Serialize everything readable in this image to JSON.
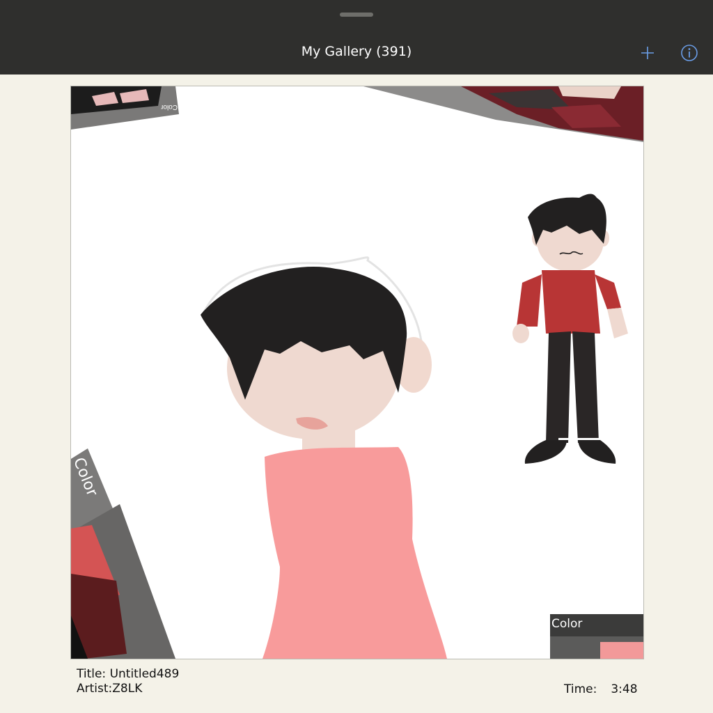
{
  "header": {
    "title": "My Gallery (391)",
    "add_icon": "plus-icon",
    "info_icon": "info-icon",
    "accent": "#6b9ee8"
  },
  "artwork": {
    "panel_labels": [
      "Color",
      "Color",
      "Color"
    ],
    "colors": {
      "hair": "#222020",
      "skin": "#efd9d0",
      "shirt_large": "#f89b9b",
      "shirt_small": "#b83535",
      "pants": "#2a2626"
    }
  },
  "footer": {
    "title_label": "Title: ",
    "title_value": "Untitled489",
    "artist_label": "Artist:",
    "artist_value": "Z8LK",
    "time_label": "Time:",
    "time_value": "3:48"
  }
}
